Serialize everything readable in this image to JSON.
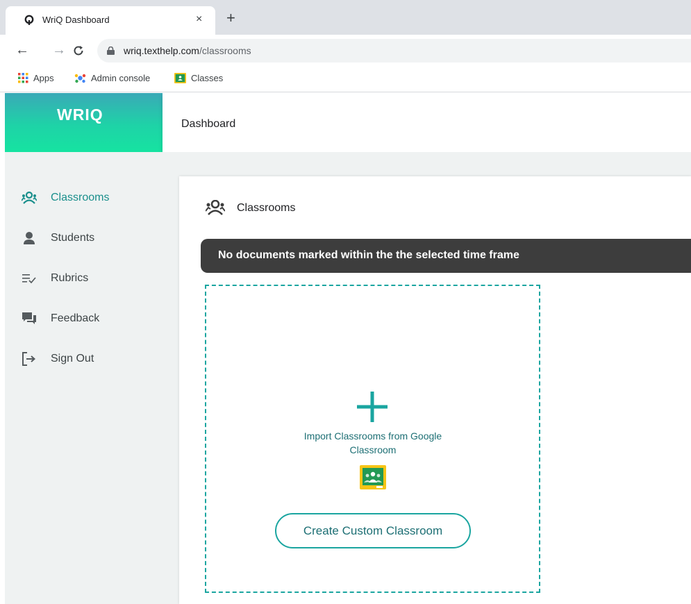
{
  "browser": {
    "tab_title": "WriQ Dashboard",
    "tab_close": "×",
    "new_tab": "+",
    "url_host": "wriq.texthelp.com",
    "url_path": "/classrooms",
    "nav": {
      "back": "←",
      "forward": "→",
      "reload": "C"
    },
    "bookmarks": [
      {
        "label": "Apps",
        "icon": "apps-grid-icon"
      },
      {
        "label": "Admin console",
        "icon": "admin-console-icon"
      },
      {
        "label": "Classes",
        "icon": "google-classroom-icon"
      }
    ]
  },
  "app": {
    "logo_text": "WRIQ",
    "header_title": "Dashboard",
    "accent_color": "#1aa5a0",
    "brand_gradient": [
      "#3aa9b7",
      "#16e3a1"
    ]
  },
  "sidebar": {
    "items": [
      {
        "label": "Classrooms",
        "icon": "classrooms-icon",
        "active": true
      },
      {
        "label": "Students",
        "icon": "student-icon",
        "active": false
      },
      {
        "label": "Rubrics",
        "icon": "rubrics-icon",
        "active": false
      },
      {
        "label": "Feedback",
        "icon": "feedback-icon",
        "active": false
      },
      {
        "label": "Sign Out",
        "icon": "sign-out-icon",
        "active": false
      }
    ]
  },
  "main": {
    "section_title": "Classrooms",
    "notice": "No documents marked within the the selected time frame",
    "import_label_line1": "Import Classrooms from Google",
    "import_label_line2": "Classroom",
    "create_button": "Create Custom Classroom"
  }
}
